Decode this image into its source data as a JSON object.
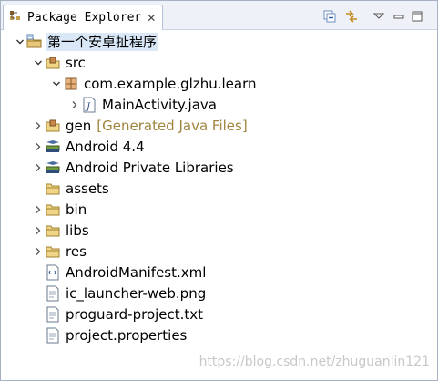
{
  "tab": {
    "title": "Package Explorer",
    "close_glyph": "✕"
  },
  "toolbar": {
    "collapse_icon": "collapse-all-icon",
    "link_icon": "link-with-editor-icon",
    "menu_icon": "view-menu-icon",
    "minimize_icon": "minimize-icon",
    "maximize_icon": "maximize-icon"
  },
  "tree": {
    "project": {
      "label": "第一个安卓扯程序",
      "expanded": true
    },
    "src": {
      "label": "src",
      "expanded": true
    },
    "package": {
      "label": "com.example.glzhu.learn",
      "expanded": true
    },
    "main_activity": {
      "label": "MainActivity.java"
    },
    "gen": {
      "label": "gen",
      "decoration": "[Generated Java Files]"
    },
    "android_lib": {
      "label": "Android 4.4"
    },
    "private_libs": {
      "label": "Android Private Libraries"
    },
    "assets": {
      "label": "assets"
    },
    "bin": {
      "label": "bin"
    },
    "libs": {
      "label": "libs"
    },
    "res": {
      "label": "res"
    },
    "manifest": {
      "label": "AndroidManifest.xml"
    },
    "ic_launcher": {
      "label": "ic_launcher-web.png"
    },
    "proguard": {
      "label": "proguard-project.txt"
    },
    "project_properties": {
      "label": "project.properties"
    }
  },
  "watermark": "https://blog.csdn.net/zhuguanlin121"
}
